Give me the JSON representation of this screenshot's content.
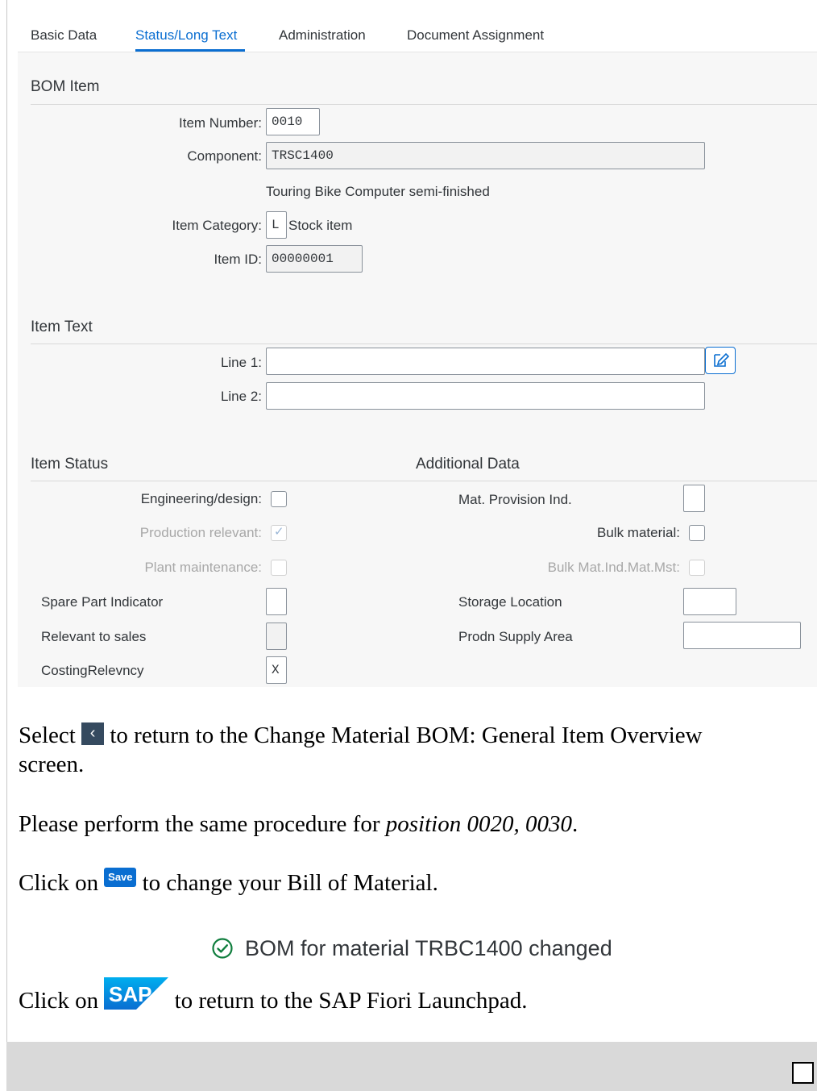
{
  "tabs": [
    {
      "label": "Basic Data"
    },
    {
      "label": "Status/Long Text"
    },
    {
      "label": "Administration"
    },
    {
      "label": "Document Assignment"
    }
  ],
  "bom_item": {
    "title": "BOM Item",
    "item_number_label": "Item Number:",
    "item_number": "0010",
    "component_label": "Component:",
    "component": "TRSC1400",
    "component_desc": "Touring Bike Computer semi-finished",
    "item_category_label": "Item Category:",
    "item_category": "L",
    "item_category_text": "Stock item",
    "item_id_label": "Item ID:",
    "item_id": "00000001"
  },
  "item_text": {
    "title": "Item Text",
    "line1_label": "Line 1:",
    "line1": "",
    "line2_label": "Line 2:",
    "line2": ""
  },
  "item_status": {
    "title": "Item Status",
    "engineering_label": "Engineering/design:",
    "production_label": "Production relevant:",
    "production_checked": true,
    "plant_label": "Plant maintenance:",
    "spare_part_label": "Spare Part Indicator",
    "spare_part": "",
    "relevant_sales_label": "Relevant to sales",
    "relevant_sales": "",
    "costing_label": "CostingRelevncy",
    "costing": "X"
  },
  "additional_data": {
    "title": "Additional Data",
    "mat_provision_label": "Mat. Provision Ind.",
    "mat_provision": "",
    "bulk_material_label": "Bulk material:",
    "bulk_mat_ind_label": "Bulk Mat.Ind.Mat.Mst:",
    "storage_location_label": "Storage Location",
    "storage_location": "",
    "prodn_supply_label": "Prodn Supply Area",
    "prodn_supply": ""
  },
  "doc": {
    "select_before": "Select",
    "select_after": "to return to the Change Material BOM: General Item Overview",
    "select_line2": "screen.",
    "back_glyph": "‹",
    "perform_before": "Please perform the same procedure for ",
    "perform_italic": "position 0020, 0030",
    "perform_after": ".",
    "click_save_before": "Click on",
    "save_label": "Save",
    "click_save_after": "to change your Bill of Material.",
    "message": "BOM for material TRBC1400 changed",
    "click_sap_before": "Click on",
    "sap_logo_text": "SAP",
    "click_sap_after": "to return to the SAP Fiori Launchpad."
  },
  "colors": {
    "accent": "#0a6ed1",
    "success": "#107e3e",
    "sap_logo": "#0a6ed1"
  }
}
